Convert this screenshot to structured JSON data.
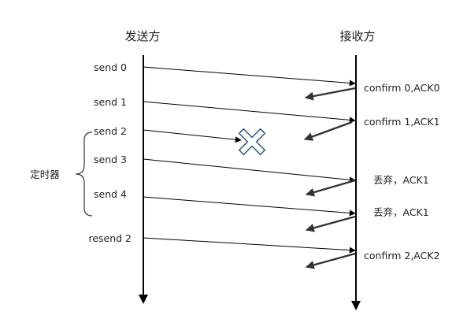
{
  "diagram": {
    "sender_title": "发送方",
    "receiver_title": "接收方",
    "timer_label": "定时器",
    "sender_labels": [
      "send 0",
      "send 1",
      "send 2",
      "send 3",
      "send 4",
      "resend 2"
    ],
    "receiver_labels": [
      "confirm 0,ACK0",
      "confirm 1,ACK1",
      "丢弃，ACK1",
      "丢弃，ACK1",
      "confirm 2,ACK2"
    ],
    "lost_marker": "cross-icon",
    "colors": {
      "line": "#000000",
      "ack_arrow": "#333333",
      "lost_fill": "#ffffff",
      "lost_stroke": "#1f4e79"
    }
  }
}
